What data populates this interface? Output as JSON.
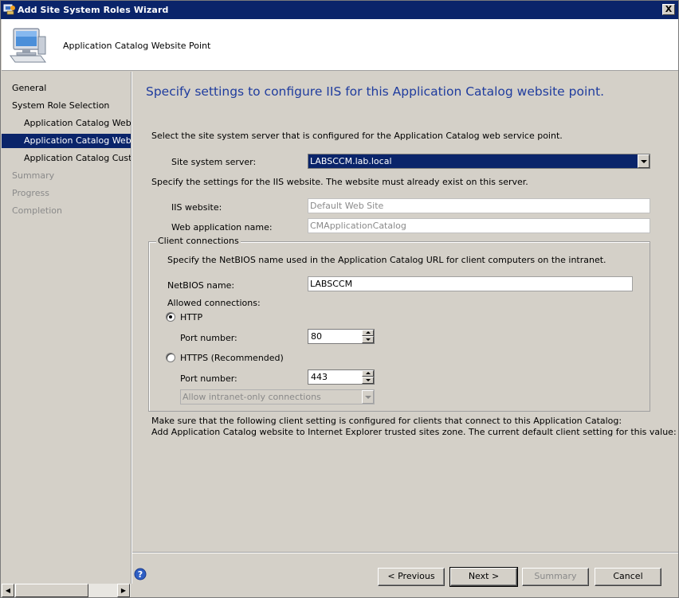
{
  "window": {
    "title": "Add Site System Roles Wizard",
    "close_label": "X"
  },
  "header": {
    "title": "Application Catalog Website Point",
    "icon": "computer-icon"
  },
  "sidebar": {
    "items": [
      {
        "label": "General",
        "state": "normal"
      },
      {
        "label": "System Role Selection",
        "state": "normal"
      },
      {
        "label": "Application Catalog Web Se",
        "state": "normal"
      },
      {
        "label": "Application Catalog Website",
        "state": "active"
      },
      {
        "label": "Application Catalog Customi",
        "state": "normal"
      },
      {
        "label": "Summary",
        "state": "disabled"
      },
      {
        "label": "Progress",
        "state": "disabled"
      },
      {
        "label": "Completion",
        "state": "disabled"
      }
    ]
  },
  "main": {
    "heading": "Specify settings to configure IIS for this Application Catalog website point.",
    "select_server_text": "Select the site system server that is configured for the Application Catalog web service point.",
    "site_system_server_label": "Site system server:",
    "site_system_server_value": "LABSCCM.lab.local",
    "iis_settings_text": "Specify the settings for the IIS website. The website must already exist on this server.",
    "iis_website_label": "IIS website:",
    "iis_website_value": "Default Web Site",
    "web_app_name_label": "Web application name:",
    "web_app_name_value": "CMApplicationCatalog",
    "client_connections": {
      "legend": "Client connections",
      "netbios_text": "Specify the NetBIOS name used in the Application Catalog URL for client computers on the intranet.",
      "netbios_label": "NetBIOS name:",
      "netbios_value": "LABSCCM",
      "allowed_connections_label": "Allowed connections:",
      "http_label": "HTTP",
      "http_port_label": "Port number:",
      "http_port_value": "80",
      "https_label": "HTTPS (Recommended)",
      "https_port_label": "Port number:",
      "https_port_value": "443",
      "https_option_value": "Allow intranet-only connections"
    },
    "note_line1": "Make sure that the following client setting is configured for clients that connect to this Application Catalog:",
    "note_line2": "Add Application Catalog website to Internet Explorer trusted sites zone. The current default client setting for this value: False"
  },
  "footer": {
    "previous_label": "< Previous",
    "next_label": "Next >",
    "summary_label": "Summary",
    "cancel_label": "Cancel"
  },
  "colors": {
    "title_bar": "#0a246a",
    "heading": "#1f3c9e",
    "selection": "#0a246a",
    "window_bg": "#d4d0c8"
  }
}
